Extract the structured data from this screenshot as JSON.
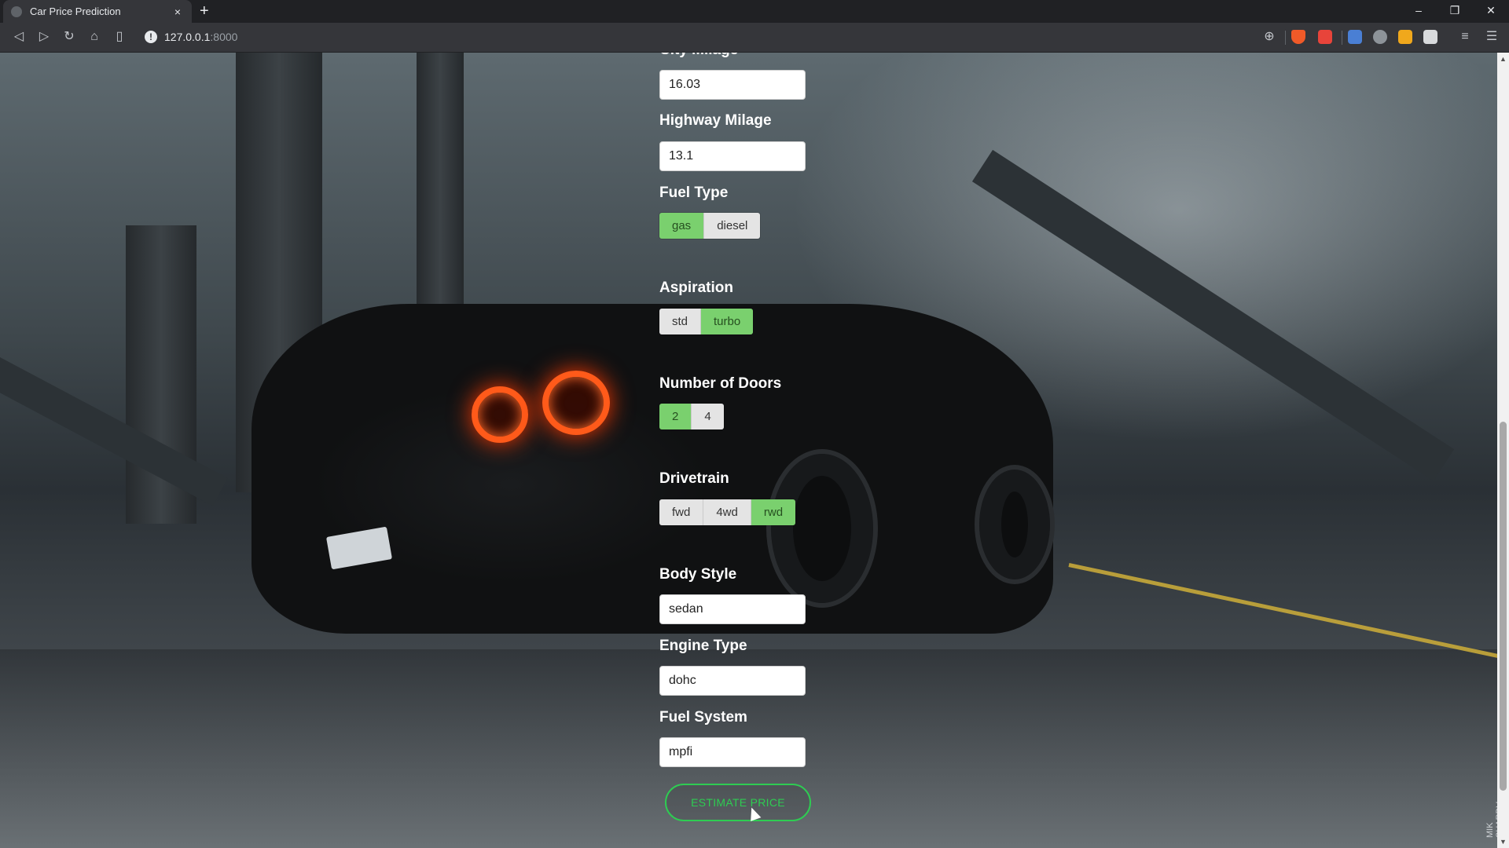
{
  "browser": {
    "tab_title": "Car Price Prediction",
    "tab_close": "×",
    "new_tab": "+",
    "url_host": "127.0.0.1",
    "url_port": ":8000",
    "window_controls": [
      "–",
      "❐",
      "✕"
    ]
  },
  "form": {
    "city_mileage": {
      "label": "City Milage",
      "value": "16.03"
    },
    "highway_mileage": {
      "label": "Highway Milage",
      "value": "13.1"
    },
    "fuel_type": {
      "label": "Fuel Type",
      "options": [
        "gas",
        "diesel"
      ],
      "selected": "gas"
    },
    "aspiration": {
      "label": "Aspiration",
      "options": [
        "std",
        "turbo"
      ],
      "selected": "turbo"
    },
    "doors": {
      "label": "Number of Doors",
      "options": [
        "2",
        "4"
      ],
      "selected": "2"
    },
    "drivetrain": {
      "label": "Drivetrain",
      "options": [
        "fwd",
        "4wd",
        "rwd"
      ],
      "selected": "rwd"
    },
    "body_style": {
      "label": "Body Style",
      "value": "sedan"
    },
    "engine_type": {
      "label": "Engine Type",
      "value": "dohc"
    },
    "fuel_system": {
      "label": "Fuel System",
      "value": "mpfi"
    },
    "submit_label": "ESTIMATE PRICE"
  },
  "background": {
    "watermark": "MIK SHARDV"
  },
  "colors": {
    "selected_option": "#7ad06e",
    "button_accent": "#2ecc52"
  }
}
